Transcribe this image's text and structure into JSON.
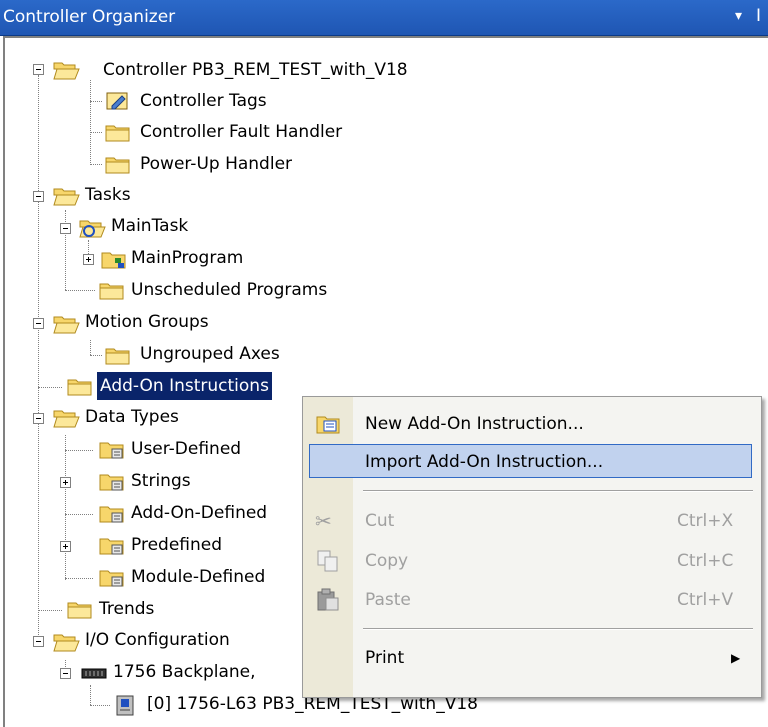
{
  "window": {
    "title": "Controller Organizer",
    "pin_glyph": "▾",
    "extra_glyph": "I"
  },
  "tree": {
    "controller": "Controller PB3_REM_TEST_with_V18",
    "controller_tags": "Controller Tags",
    "controller_fault_handler": "Controller Fault Handler",
    "power_up_handler": "Power-Up Handler",
    "tasks": "Tasks",
    "main_task": "MainTask",
    "main_program": "MainProgram",
    "unscheduled_programs": "Unscheduled Programs",
    "motion_groups": "Motion Groups",
    "ungrouped_axes": "Ungrouped Axes",
    "add_on_instructions": "Add-On Instructions",
    "data_types": "Data Types",
    "user_defined": "User-Defined",
    "strings": "Strings",
    "add_on_defined": "Add-On-Defined",
    "predefined": "Predefined",
    "module_defined": "Module-Defined",
    "trends": "Trends",
    "io_configuration": "I/O Configuration",
    "backplane": "1756 Backplane,",
    "controller_module": "[0] 1756-L63 PB3_REM_TEST_with_V18"
  },
  "context_menu": {
    "new_aoi": "New Add-On Instruction...",
    "import_aoi": "Import Add-On Instruction...",
    "cut": "Cut",
    "cut_shortcut": "Ctrl+X",
    "copy": "Copy",
    "copy_shortcut": "Ctrl+C",
    "paste": "Paste",
    "paste_shortcut": "Ctrl+V",
    "print": "Print"
  },
  "colors": {
    "titlebar": "#1f56b3",
    "selection": "#0a246a",
    "menu_hover": "#c1d2ee",
    "folder": "#f7d66b"
  }
}
